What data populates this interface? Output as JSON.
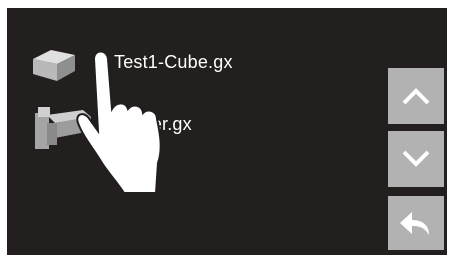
{
  "files": [
    {
      "name": "Test1-Cube.gx",
      "thumbnail": "cube-icon"
    },
    {
      "name": "Holder.gx",
      "thumbnail": "holder-icon"
    }
  ],
  "buttons": {
    "scroll_up": "chevron-up-icon",
    "scroll_down": "chevron-down-icon",
    "back": "back-arrow-icon"
  },
  "overlay": "tap-hand-icon",
  "colors": {
    "screen_background": "#231f1e",
    "button_background": "#b2b2b2",
    "text": "#ffffff"
  }
}
